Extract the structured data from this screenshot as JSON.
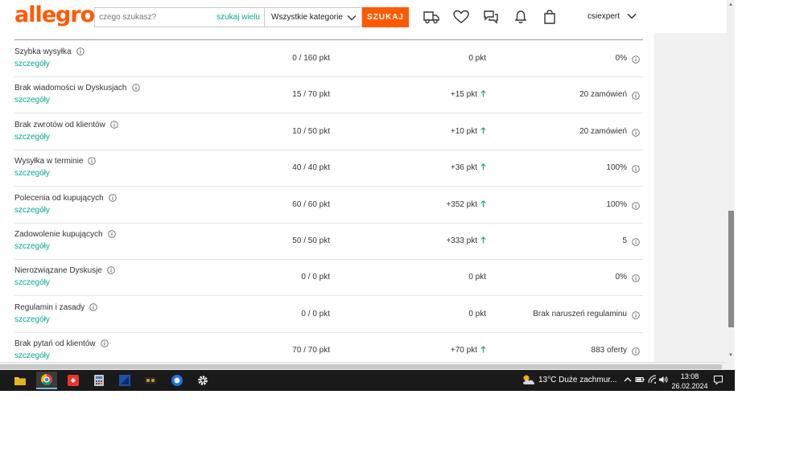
{
  "header": {
    "logo": "allegro",
    "search_placeholder": "czego szukasz?",
    "search_many": "szukaj wielu",
    "category": "Wszystkie kategorie",
    "search_button": "SZUKAJ",
    "username": "csiexpert"
  },
  "table": {
    "details_label": "szczegóły",
    "rows": [
      {
        "name": "Szybka wysyłka",
        "points": "0 / 160 pkt",
        "change": "0 pkt",
        "up": false,
        "value": "0%"
      },
      {
        "name": "Brak wiadomości w Dyskusjach",
        "points": "15 / 70 pkt",
        "change": "+15 pkt",
        "up": true,
        "value": "20 zamówień"
      },
      {
        "name": "Brak zwrotów od klientów",
        "points": "10 / 50 pkt",
        "change": "+10 pkt",
        "up": true,
        "value": "20 zamówień"
      },
      {
        "name": "Wysyłka w terminie",
        "points": "40 / 40 pkt",
        "change": "+36 pkt",
        "up": true,
        "value": "100%"
      },
      {
        "name": "Polecenia od kupujących",
        "points": "60 / 60 pkt",
        "change": "+352 pkt",
        "up": true,
        "value": "100%"
      },
      {
        "name": "Zadowolenie kupujących",
        "points": "50 / 50 pkt",
        "change": "+333 pkt",
        "up": true,
        "value": "5"
      },
      {
        "name": "Nierozwiązane Dyskusje",
        "points": "0 / 0 pkt",
        "change": "0 pkt",
        "up": false,
        "value": "0%"
      },
      {
        "name": "Regulamin i zasady",
        "points": "0 / 0 pkt",
        "change": "0 pkt",
        "up": false,
        "value": "Brak naruszeń regulaminu"
      },
      {
        "name": "Brak pytań od klientów",
        "points": "70 / 70 pkt",
        "change": "+70 pkt",
        "up": true,
        "value": "883 oferty"
      }
    ]
  },
  "taskbar": {
    "weather": "13°C  Duże zachmur...",
    "time": "13:08",
    "date": "26.02.2024"
  },
  "colors": {
    "brand": "#ff5a00",
    "link": "#00a790",
    "up_arrow": "#1aa260"
  }
}
